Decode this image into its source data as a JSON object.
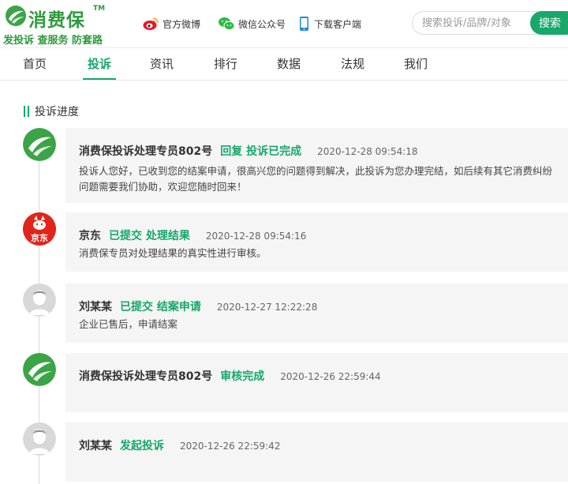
{
  "brand": {
    "name": "消费保",
    "tm": "TM",
    "slogan": "发投诉 查服务 防套路",
    "color": "#2e9a3e"
  },
  "header_links": [
    {
      "label": "官方微博",
      "icon": "weibo-icon"
    },
    {
      "label": "微信公众号",
      "icon": "wechat-icon"
    },
    {
      "label": "下载客户端",
      "icon": "phone-icon"
    }
  ],
  "search": {
    "placeholder": "搜索投诉/品牌/对象",
    "button_label": "搜索"
  },
  "nav": [
    {
      "label": "首页",
      "active": false
    },
    {
      "label": "投诉",
      "active": true
    },
    {
      "label": "资讯",
      "active": false
    },
    {
      "label": "排行",
      "active": false
    },
    {
      "label": "数据",
      "active": false
    },
    {
      "label": "法规",
      "active": false
    },
    {
      "label": "我们",
      "active": false
    }
  ],
  "accent_color": "#17a86a",
  "section_title": "投诉进度",
  "timeline": [
    {
      "author": "消费保投诉处理专员802号",
      "action": "回复 投诉已完成",
      "time": "2020-12-28 09:54:18",
      "body": "投诉人您好，已收到您的结案申请，很高兴您的问题得到解决，此投诉为您办理完结，如后续有其它消费纠纷问题需要我们协助，欢迎您随时回来！",
      "avatar": "xiaofeibao-logo"
    },
    {
      "author": "京东",
      "action": "已提交 处理结果",
      "time": "2020-12-28 09:54:16",
      "body": "消费保专员对处理结果的真实性进行审核。",
      "avatar": "jd-logo",
      "avatar_text": "京东"
    },
    {
      "author": "刘某某",
      "action": "已提交 结案申请",
      "time": "2020-12-27 12:22:28",
      "body": "企业已售后，申请结案",
      "avatar": "user-avatar"
    },
    {
      "author": "消费保投诉处理专员802号",
      "action": "审核完成",
      "time": "2020-12-26 22:59:44",
      "body": "",
      "avatar": "xiaofeibao-logo"
    },
    {
      "author": "刘某某",
      "action": "发起投诉",
      "time": "2020-12-26 22:59:42",
      "body": "",
      "avatar": "user-avatar"
    }
  ]
}
